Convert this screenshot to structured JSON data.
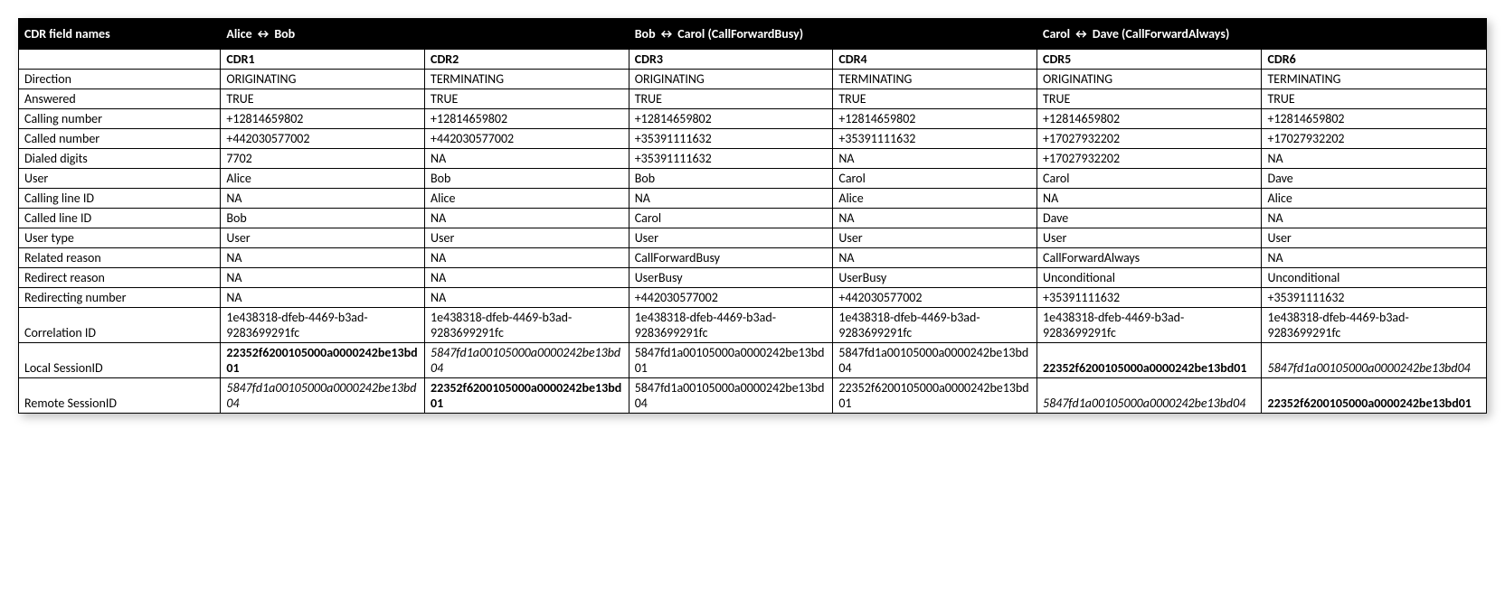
{
  "headers": {
    "col0": "CDR field names",
    "group1": "Alice ↔ Bob",
    "group2": "Bob ↔ Carol (CallForwardBusy)",
    "group3": "Carol ↔ Dave (CallForwardAlways)"
  },
  "subheaders": {
    "c0": "",
    "c1": "CDR1",
    "c2": "CDR2",
    "c3": "CDR3",
    "c4": "CDR4",
    "c5": "CDR5",
    "c6": "CDR6"
  },
  "rows": [
    {
      "label": "Direction",
      "c1": {
        "t": "ORIGINATING"
      },
      "c2": {
        "t": "TERMINATING"
      },
      "c3": {
        "t": "ORIGINATING"
      },
      "c4": {
        "t": "TERMINATING"
      },
      "c5": {
        "t": "ORIGINATING"
      },
      "c6": {
        "t": "TERMINATING"
      }
    },
    {
      "label": "Answered",
      "c1": {
        "t": "TRUE"
      },
      "c2": {
        "t": "TRUE"
      },
      "c3": {
        "t": "TRUE"
      },
      "c4": {
        "t": "TRUE"
      },
      "c5": {
        "t": "TRUE"
      },
      "c6": {
        "t": "TRUE"
      }
    },
    {
      "label": "Calling number",
      "c1": {
        "t": "+12814659802"
      },
      "c2": {
        "t": "+12814659802"
      },
      "c3": {
        "t": "+12814659802"
      },
      "c4": {
        "t": "+12814659802"
      },
      "c5": {
        "t": "+12814659802"
      },
      "c6": {
        "t": "+12814659802"
      }
    },
    {
      "label": "Called number",
      "c1": {
        "t": "+442030577002"
      },
      "c2": {
        "t": "+442030577002"
      },
      "c3": {
        "t": "+35391111632"
      },
      "c4": {
        "t": "+35391111632"
      },
      "c5": {
        "t": "+17027932202"
      },
      "c6": {
        "t": "+17027932202"
      }
    },
    {
      "label": "Dialed digits",
      "c1": {
        "t": "7702"
      },
      "c2": {
        "t": "NA"
      },
      "c3": {
        "t": "+35391111632"
      },
      "c4": {
        "t": "NA"
      },
      "c5": {
        "t": "+17027932202"
      },
      "c6": {
        "t": "NA"
      }
    },
    {
      "label": "User",
      "c1": {
        "t": "Alice"
      },
      "c2": {
        "t": "Bob"
      },
      "c3": {
        "t": "Bob"
      },
      "c4": {
        "t": "Carol"
      },
      "c5": {
        "t": "Carol"
      },
      "c6": {
        "t": "Dave"
      }
    },
    {
      "label": "Calling line ID",
      "c1": {
        "t": "NA"
      },
      "c2": {
        "t": "Alice"
      },
      "c3": {
        "t": "NA"
      },
      "c4": {
        "t": "Alice"
      },
      "c5": {
        "t": "NA"
      },
      "c6": {
        "t": "Alice"
      }
    },
    {
      "label": "Called line ID",
      "c1": {
        "t": "Bob"
      },
      "c2": {
        "t": "NA"
      },
      "c3": {
        "t": "Carol"
      },
      "c4": {
        "t": "NA"
      },
      "c5": {
        "t": "Dave"
      },
      "c6": {
        "t": "NA"
      }
    },
    {
      "label": "User type",
      "c1": {
        "t": "User"
      },
      "c2": {
        "t": "User"
      },
      "c3": {
        "t": "User"
      },
      "c4": {
        "t": "User"
      },
      "c5": {
        "t": "User"
      },
      "c6": {
        "t": "User"
      }
    },
    {
      "label": "Related reason",
      "c1": {
        "t": "NA"
      },
      "c2": {
        "t": "NA"
      },
      "c3": {
        "t": "CallForwardBusy"
      },
      "c4": {
        "t": "NA"
      },
      "c5": {
        "t": "CallForwardAlways"
      },
      "c6": {
        "t": "NA"
      }
    },
    {
      "label": "Redirect reason",
      "c1": {
        "t": "NA"
      },
      "c2": {
        "t": "NA"
      },
      "c3": {
        "t": "UserBusy"
      },
      "c4": {
        "t": "UserBusy"
      },
      "c5": {
        "t": "Unconditional"
      },
      "c6": {
        "t": "Unconditional"
      }
    },
    {
      "label": "Redirecting number",
      "c1": {
        "t": "NA"
      },
      "c2": {
        "t": "NA"
      },
      "c3": {
        "t": "+442030577002"
      },
      "c4": {
        "t": "+442030577002"
      },
      "c5": {
        "t": "+35391111632"
      },
      "c6": {
        "t": "+35391111632"
      }
    },
    {
      "label": "Correlation ID",
      "c1": {
        "t": "1e438318-dfeb-4469-b3ad-9283699291fc"
      },
      "c2": {
        "t": "1e438318-dfeb-4469-b3ad-9283699291fc"
      },
      "c3": {
        "t": "1e438318-dfeb-4469-b3ad-9283699291fc"
      },
      "c4": {
        "t": "1e438318-dfeb-4469-b3ad-9283699291fc"
      },
      "c5": {
        "t": "1e438318-dfeb-4469-b3ad-9283699291fc"
      },
      "c6": {
        "t": "1e438318-dfeb-4469-b3ad-9283699291fc"
      }
    },
    {
      "label": "Local SessionID",
      "c1": {
        "t": "22352f6200105000a0000242be13bd01",
        "b": true
      },
      "c2": {
        "t": "5847fd1a00105000a0000242be13bd04",
        "i": true
      },
      "c3": {
        "t": "5847fd1a00105000a0000242be13bd01"
      },
      "c4": {
        "t": "5847fd1a00105000a0000242be13bd04"
      },
      "c5": {
        "t": "22352f6200105000a0000242be13bd01",
        "b": true
      },
      "c6": {
        "t": "5847fd1a00105000a0000242be13bd04",
        "i": true
      }
    },
    {
      "label": "Remote SessionID",
      "c1": {
        "t": "5847fd1a00105000a0000242be13bd04",
        "i": true
      },
      "c2": {
        "t": "22352f6200105000a0000242be13bd01",
        "b": true
      },
      "c3": {
        "t": "5847fd1a00105000a0000242be13bd04"
      },
      "c4": {
        "t": "22352f6200105000a0000242be13bd01"
      },
      "c5": {
        "t": "5847fd1a00105000a0000242be13bd04",
        "i": true
      },
      "c6": {
        "t": "22352f6200105000a0000242be13bd01",
        "b": true
      }
    }
  ]
}
